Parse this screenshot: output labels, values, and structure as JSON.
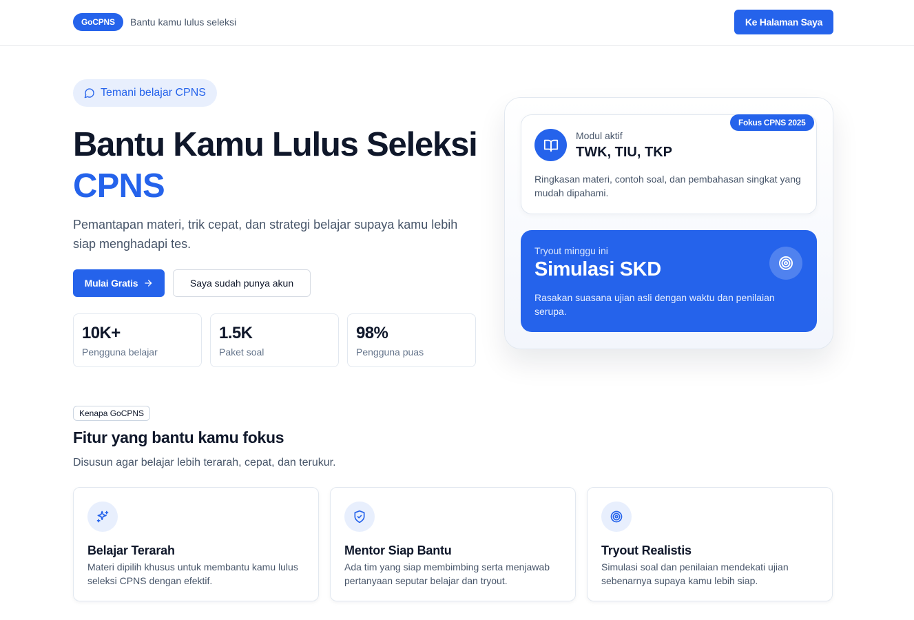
{
  "header": {
    "brand": "GoCPNS",
    "tagline": "Bantu kamu lulus seleksi",
    "cta": "Ke Halaman Saya"
  },
  "hero": {
    "chip": "Temani belajar CPNS",
    "title": "Bantu Kamu Lulus Seleksi",
    "title_accent": "CPNS",
    "description": "Pemantapan materi, trik cepat, dan strategi belajar supaya kamu lebih siap menghadapi tes.",
    "primary_button": "Mulai Gratis",
    "secondary_button": "Saya sudah punya akun",
    "stats": [
      {
        "value": "10K+",
        "label": "Pengguna belajar"
      },
      {
        "value": "1.5K",
        "label": "Paket soal"
      },
      {
        "value": "98%",
        "label": "Pengguna puas"
      }
    ]
  },
  "panel": {
    "badge": "Fokus CPNS 2025",
    "module_label": "Modul aktif",
    "module_value": "TWK, TIU, TKP",
    "module_desc": "Ringkasan materi, contoh soal, dan pembahasan singkat yang mudah dipahami.",
    "tryout_label": "Tryout minggu ini",
    "tryout_title": "Simulasi SKD",
    "tryout_desc": "Rasakan suasana ujian asli dengan waktu dan penilaian serupa."
  },
  "features": {
    "eyebrow": "Kenapa GoCPNS",
    "title": "Fitur yang bantu kamu fokus",
    "subtitle": "Disusun agar belajar lebih terarah, cepat, dan terukur.",
    "items": [
      {
        "title": "Belajar Terarah",
        "desc": "Materi dipilih khusus untuk membantu kamu lulus seleksi CPNS dengan efektif.",
        "icon": "sparkles-icon"
      },
      {
        "title": "Mentor Siap Bantu",
        "desc": "Ada tim yang siap membimbing serta menjawab pertanyaan seputar belajar dan tryout.",
        "icon": "shield-check-icon"
      },
      {
        "title": "Tryout Realistis",
        "desc": "Simulasi soal dan penilaian mendekati ujian sebenarnya supaya kamu lebih siap.",
        "icon": "target-icon"
      }
    ]
  },
  "colors": {
    "primary": "#2563eb",
    "text": "#0f172a",
    "muted": "#475569"
  }
}
